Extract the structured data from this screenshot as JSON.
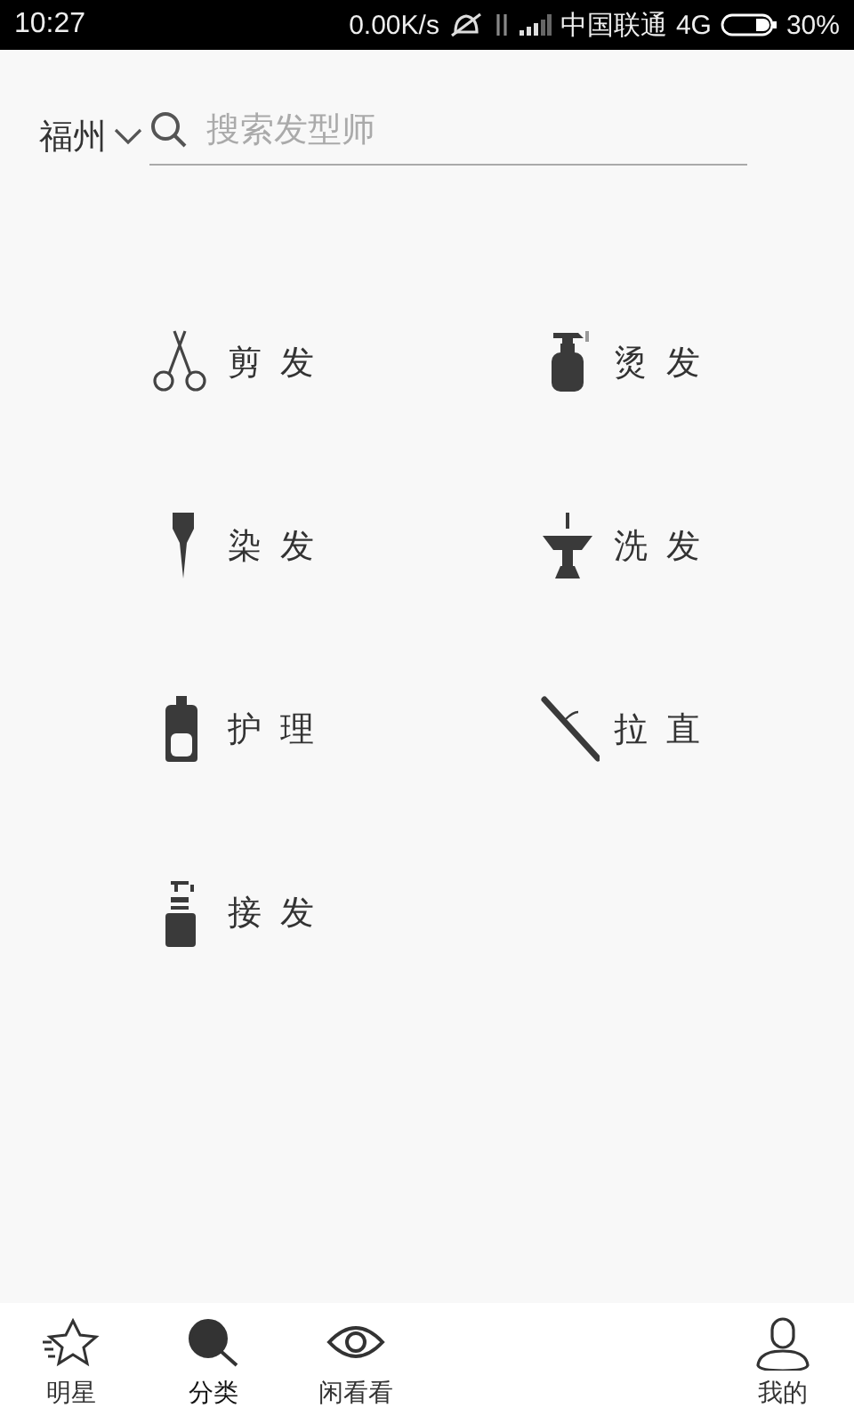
{
  "status_bar": {
    "time": "10:27",
    "speed": "0.00K/s",
    "carrier": "中国联通",
    "network": "4G",
    "battery": "30%"
  },
  "header": {
    "city": "福州",
    "search": {
      "placeholder": "搜索发型师"
    }
  },
  "categories": [
    {
      "label": "剪发",
      "kind": "scissors"
    },
    {
      "label": "烫发",
      "kind": "spray"
    },
    {
      "label": "染发",
      "kind": "brush"
    },
    {
      "label": "洗发",
      "kind": "basin"
    },
    {
      "label": "护理",
      "kind": "bottle"
    },
    {
      "label": "拉直",
      "kind": "straightener"
    },
    {
      "label": "接发",
      "kind": "pump"
    }
  ],
  "bottom_nav": [
    {
      "label": "明星",
      "kind": "star",
      "selected": false
    },
    {
      "label": "分类",
      "kind": "search",
      "selected": true
    },
    {
      "label": "闲看看",
      "kind": "eye",
      "selected": false
    },
    {
      "label": "我的",
      "kind": "person",
      "selected": false
    }
  ]
}
